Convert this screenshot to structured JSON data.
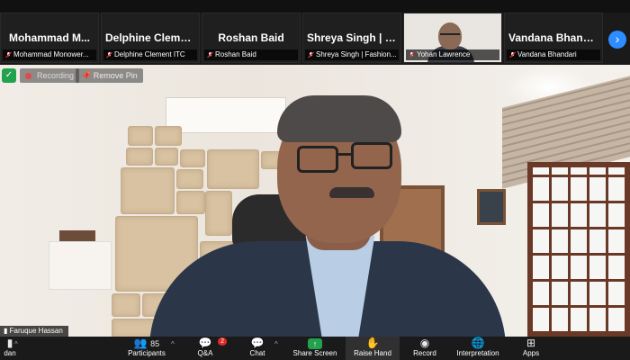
{
  "participants": [
    {
      "display_name": "Mohammad  M...",
      "label": "Mohammad Monower..."
    },
    {
      "display_name": "Delphine  Cleme...",
      "label": "Delphine Clement ITC"
    },
    {
      "display_name": "Roshan Baid",
      "label": "Roshan Baid"
    },
    {
      "display_name": "Shreya Singh | F...",
      "label": "Shreya Singh | Fashion..."
    },
    {
      "display_name": "",
      "label": "Yohan Lawrence"
    },
    {
      "display_name": "Vandana  Bhand...",
      "label": "Vandana Bhandari"
    }
  ],
  "main_video": {
    "speaker_label": "Faruque Hassan",
    "recording_text": "Recording",
    "remove_pin_label": "Remove Pin"
  },
  "toolbar": {
    "left_label": "dan",
    "participants_count": "85",
    "participants_label": "Participants",
    "qa_label": "Q&A",
    "qa_badge": "2",
    "chat_label": "Chat",
    "share_label": "Share Screen",
    "raise_label": "Raise Hand",
    "record_label": "Record",
    "interpretation_label": "Interpretation",
    "apps_label": "Apps"
  },
  "colors": {
    "accent_blue": "#2d8cff",
    "share_green": "#23a24d",
    "mute_red": "#e02828",
    "background": "#1a1a1a"
  }
}
